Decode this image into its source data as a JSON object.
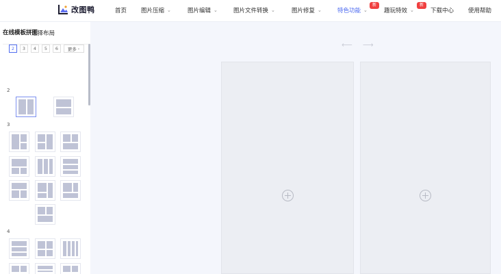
{
  "logo": {
    "text": "改图鸭",
    "icon": "photo-mountain-icon"
  },
  "nav": [
    {
      "label": "首页",
      "chevron": false
    },
    {
      "label": "图片压缩",
      "chevron": true
    },
    {
      "label": "图片编辑",
      "chevron": true
    },
    {
      "label": "图片文件转换",
      "chevron": true
    },
    {
      "label": "图片修复",
      "chevron": true
    },
    {
      "label": "特色功能",
      "chevron": true,
      "active": true,
      "badge": "新"
    },
    {
      "label": "趣玩特效",
      "chevron": true,
      "badge": "新"
    },
    {
      "label": "下载中心",
      "chevron": false
    },
    {
      "label": "使用帮助",
      "chevron": false
    }
  ],
  "sidebar": {
    "title": "在线模板拼图",
    "panel_heading": "选择布局",
    "counts": [
      "2",
      "3",
      "4",
      "5",
      "6"
    ],
    "more": "更多",
    "groups": [
      "2",
      "3",
      "4"
    ]
  },
  "toolbar": {
    "undo_icon": "undo-arrow-icon",
    "redo_icon": "redo-arrow-icon"
  },
  "canvas": {
    "slot_icon": "plus-circle-icon"
  },
  "colors": {
    "accent": "#4f6cf0",
    "badge": "#f04040",
    "thumb_fill": "#bfc3d6"
  }
}
